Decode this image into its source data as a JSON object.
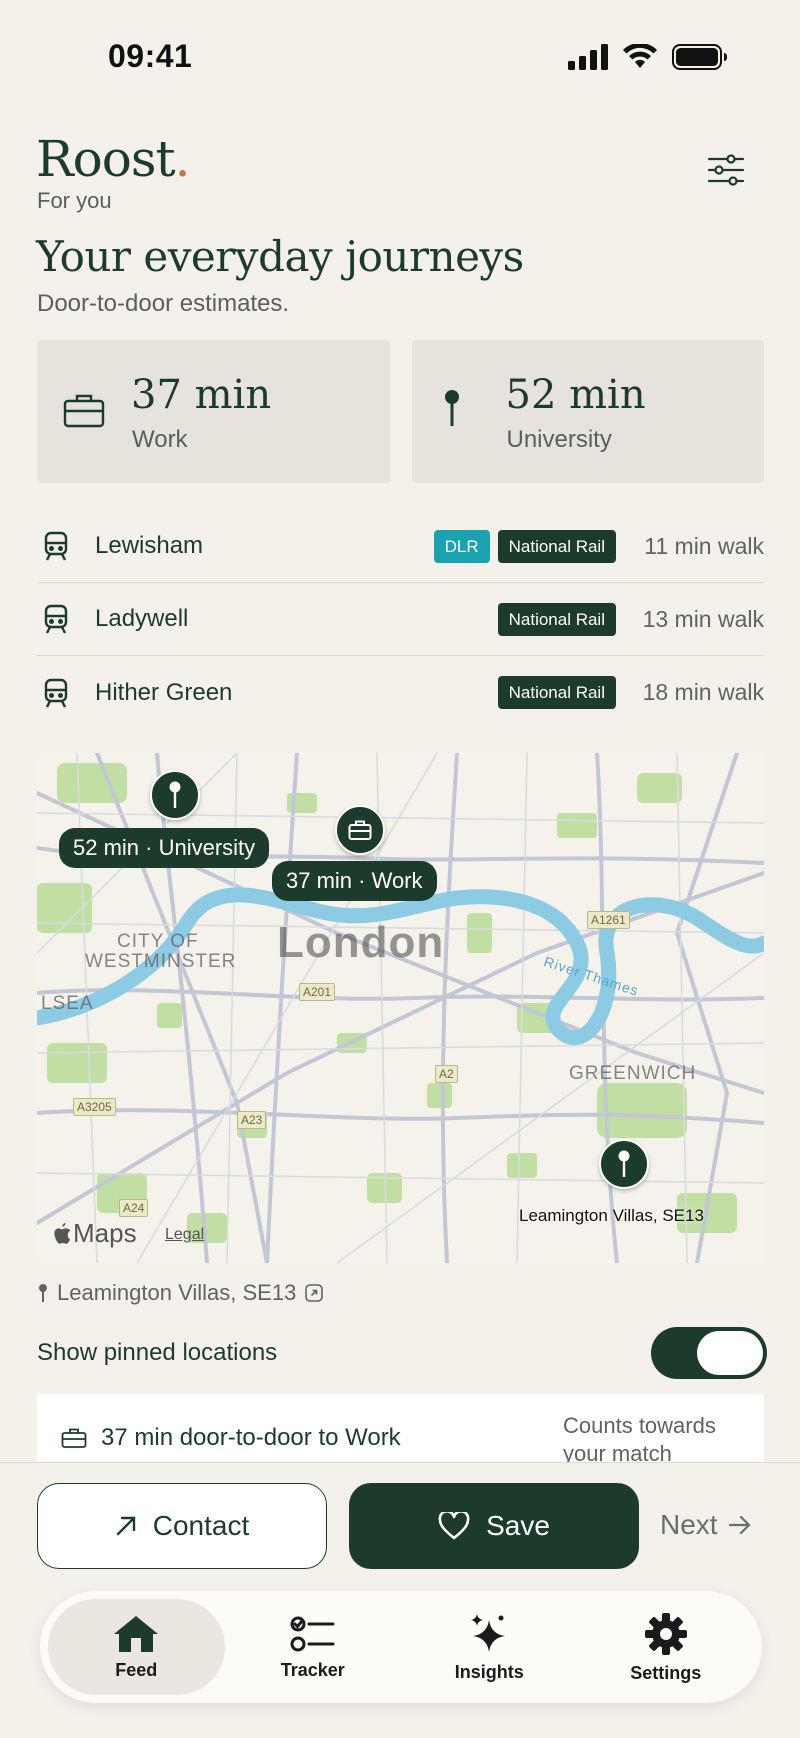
{
  "status": {
    "time": "09:41"
  },
  "header": {
    "brand": "Roost",
    "brand_dot": ".",
    "subtitle": "For you"
  },
  "journeys": {
    "title": "Your everyday journeys",
    "subtitle": "Door-to-door estimates.",
    "cards": [
      {
        "icon": "briefcase-icon",
        "minutes": "37 min",
        "label": "Work"
      },
      {
        "icon": "pin-icon",
        "minutes": "52 min",
        "label": "University"
      }
    ]
  },
  "stations": [
    {
      "name": "Lewisham",
      "badges": [
        "DLR",
        "National Rail"
      ],
      "walk": "11 min walk"
    },
    {
      "name": "Ladywell",
      "badges": [
        "National Rail"
      ],
      "walk": "13 min walk"
    },
    {
      "name": "Hither Green",
      "badges": [
        "National Rail"
      ],
      "walk": "18 min walk"
    }
  ],
  "map": {
    "city": "London",
    "labels": {
      "university": "52 min · University",
      "work": "37 min · Work",
      "home": "Leamington Villas, SE13"
    },
    "areas": {
      "westminster_1": "CITY OF",
      "westminster_2": "WESTMINSTER",
      "greenwich": "GREENWICH",
      "chelsea": "LSEA",
      "river": "River Thames"
    },
    "roads": [
      "A1261",
      "A201",
      "A2",
      "A3205",
      "A23",
      "A24"
    ],
    "attribution": {
      "logo": "Maps",
      "legal": "Legal"
    }
  },
  "location": {
    "text": "Leamington Villas, SE13"
  },
  "toggle": {
    "label": "Show pinned locations",
    "on": true
  },
  "match_card": {
    "text": "37 min door-to-door to Work",
    "note": "Counts towards your match"
  },
  "actions": {
    "contact": "Contact",
    "save": "Save",
    "next": "Next"
  },
  "tabs": [
    {
      "label": "Feed",
      "icon": "home-icon",
      "active": true
    },
    {
      "label": "Tracker",
      "icon": "checklist-icon",
      "active": false
    },
    {
      "label": "Insights",
      "icon": "sparkles-icon",
      "active": false
    },
    {
      "label": "Settings",
      "icon": "gear-icon",
      "active": false
    }
  ],
  "colors": {
    "primary": "#1d3b2c",
    "background": "#f4f0ea",
    "accent_dot": "#d0703c",
    "dlr": "#1aa3ae",
    "card": "#e6e3dc"
  }
}
